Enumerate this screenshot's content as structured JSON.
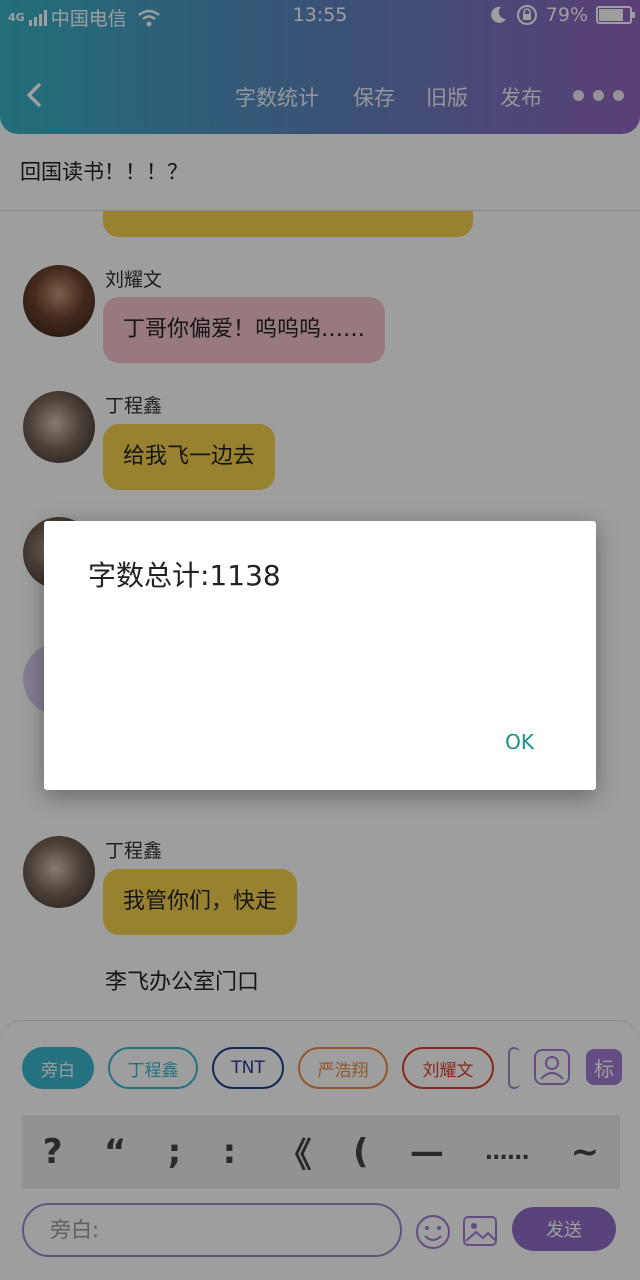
{
  "status_bar": {
    "network": "4G",
    "carrier": "中国电信",
    "time": "13:55",
    "battery": "79%",
    "battery_level": 0.79
  },
  "toolbar": {
    "word_count": "字数统计",
    "save": "保存",
    "old_version": "旧版",
    "publish": "发布"
  },
  "story_title": "回国读书！！！？",
  "messages": [
    {
      "name": "刘耀文",
      "text": "丁哥你偏爱！呜呜呜……"
    },
    {
      "name": "丁程鑫",
      "text": "给我飞一边去"
    },
    {
      "name": "丁程鑫",
      "text": "我管你们，快走"
    }
  ],
  "narration": "李飞办公室门口",
  "role_chips": [
    "旁白",
    "丁程鑫",
    "TNT",
    "严浩翔",
    "刘耀文"
  ],
  "tag_label": "标",
  "punctuation": [
    "?",
    "“",
    ";",
    ":",
    "《",
    "(",
    "—",
    "……",
    "~"
  ],
  "input_placeholder": "旁白:",
  "send_label": "发送",
  "dialog": {
    "message": "字数总计:1138",
    "ok": "OK"
  },
  "colors": {
    "accent": "#8e6fc7",
    "bubble_yellow": "#f6d24e",
    "bubble_pink": "#f5c5cc",
    "dialog_button": "#12948a"
  }
}
